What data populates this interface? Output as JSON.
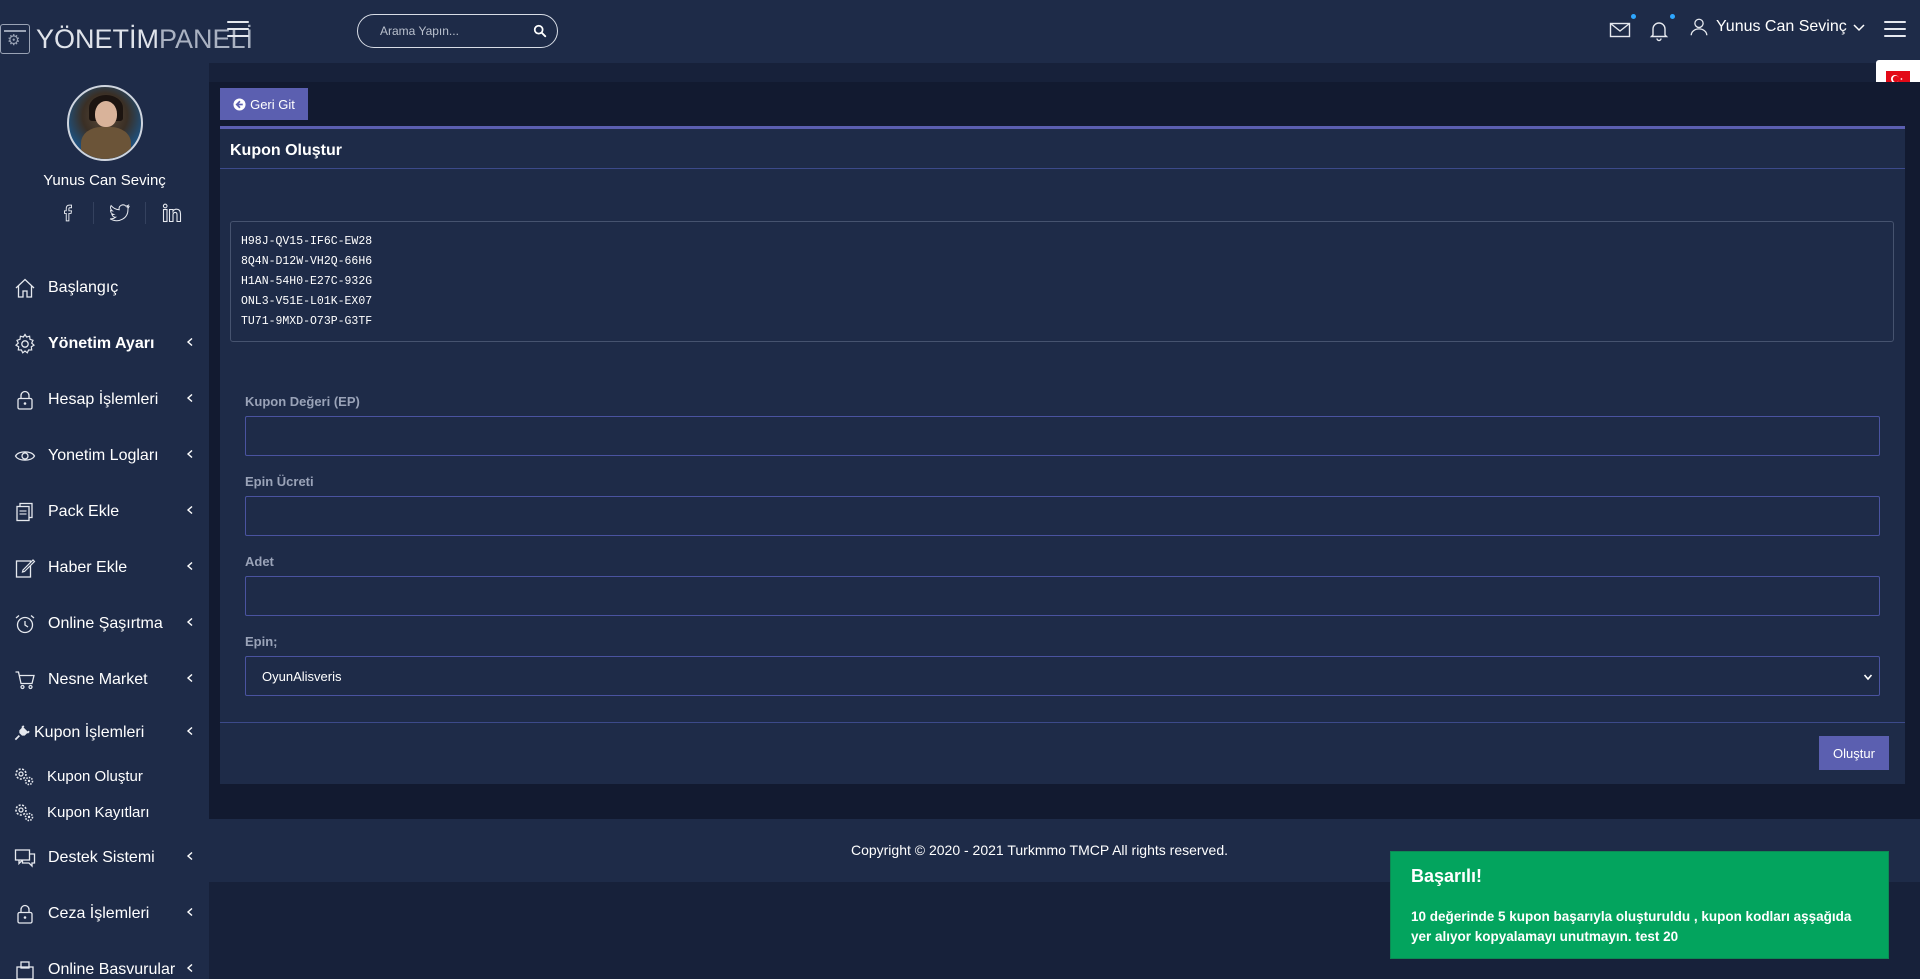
{
  "header": {
    "logo_bold": "YÖNETİM",
    "logo_light": "PANELİ",
    "search_placeholder": "Arama Yapın...",
    "user_name": "Yunus Can Sevinç"
  },
  "sidebar": {
    "user_name": "Yunus Can Sevinç",
    "items": [
      {
        "label": "Başlangıç"
      },
      {
        "label": "Yönetim Ayarı"
      },
      {
        "label": "Hesap İşlemleri"
      },
      {
        "label": "Yonetim Logları"
      },
      {
        "label": "Pack Ekle"
      },
      {
        "label": "Haber Ekle"
      },
      {
        "label": "Online Şaşırtma"
      },
      {
        "label": "Nesne Market"
      },
      {
        "label": "Kupon İşlemleri"
      },
      {
        "label": "Destek Sistemi"
      },
      {
        "label": "Ceza İşlemleri"
      },
      {
        "label": "Online Basvurular"
      }
    ],
    "sub_items": [
      {
        "label": "Kupon Oluştur"
      },
      {
        "label": "Kupon Kayıtları"
      }
    ]
  },
  "main": {
    "back_label": "Geri Git",
    "card_title": "Kupon Oluştur",
    "codes": [
      "H98J-QV15-IF6C-EW28",
      "8Q4N-D12W-VH2Q-66H6",
      "H1AN-54H0-E27C-932G",
      "ONL3-V51E-L01K-EX07",
      "TU71-9MXD-O73P-G3TF"
    ],
    "fields": {
      "value_label": "Kupon Değeri (EP)",
      "price_label": "Epin Ücreti",
      "count_label": "Adet",
      "epin_label": "Epin;",
      "epin_selected": "OyunAlisveris"
    },
    "submit_label": "Oluştur"
  },
  "footer": {
    "copyright": "Copyright © 2020 - 2021 Turkmmo TMCP All rights reserved."
  },
  "toast": {
    "title": "Başarılı!",
    "message": "10 değerinde 5 kupon başarıyla oluşturuldu , kupon kodları aşşağıda yer alıyor kopyalamayı unutmayın. test 20"
  }
}
